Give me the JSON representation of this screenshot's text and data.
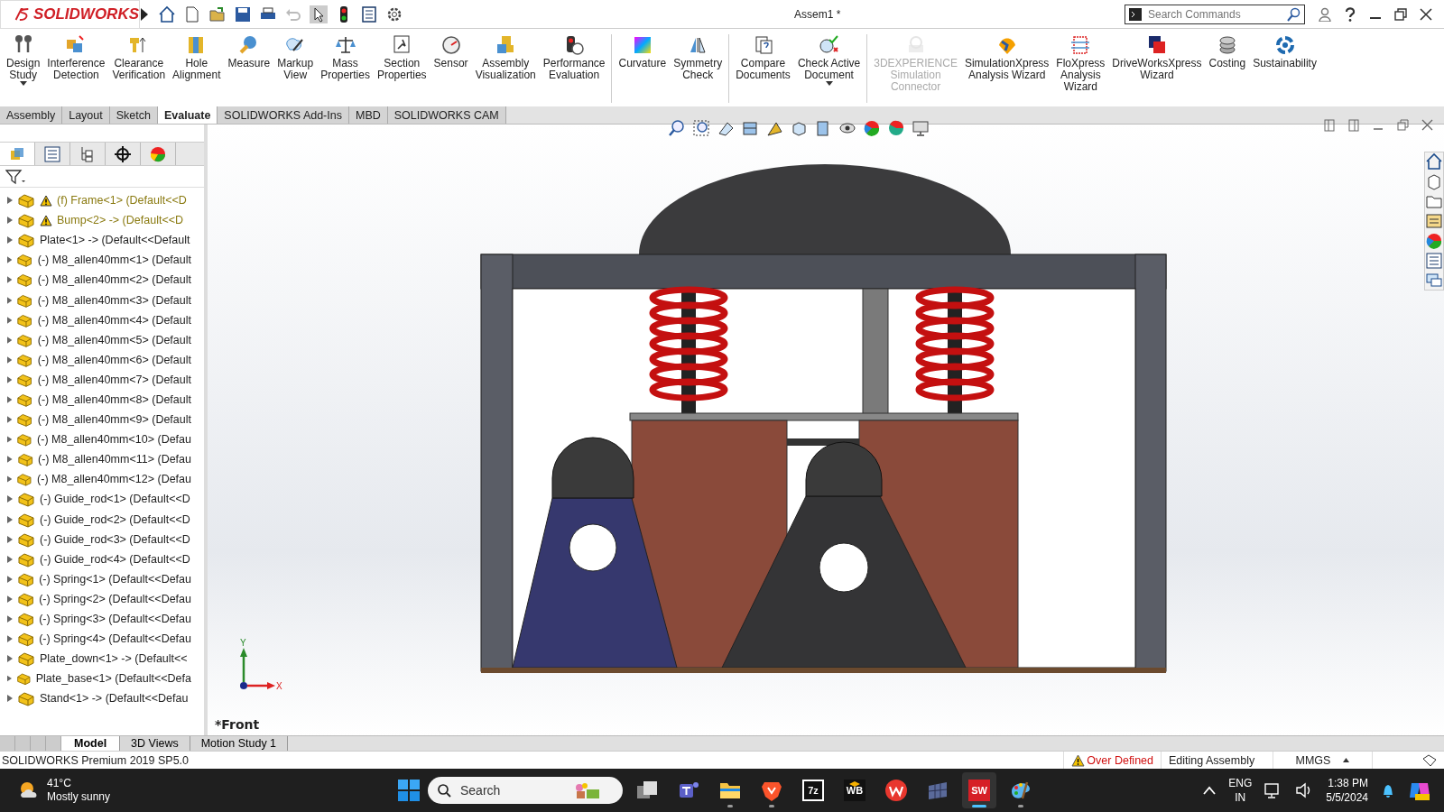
{
  "app": {
    "logo": "SOLIDWORKS",
    "title": "Assem1 *"
  },
  "search": {
    "placeholder": "Search Commands"
  },
  "ribbon": {
    "groups": [
      [
        {
          "label": "Design\nStudy",
          "dropdown": true,
          "disabled": false
        },
        {
          "label": "Interference\nDetection",
          "dropdown": false,
          "disabled": false
        },
        {
          "label": "Clearance\nVerification",
          "dropdown": false,
          "disabled": false
        },
        {
          "label": "Hole\nAlignment",
          "dropdown": false,
          "disabled": false
        },
        {
          "label": "Measure",
          "dropdown": false,
          "disabled": false
        },
        {
          "label": "Markup\nView",
          "dropdown": false,
          "disabled": false
        },
        {
          "label": "Mass\nProperties",
          "dropdown": false,
          "disabled": false
        },
        {
          "label": "Section\nProperties",
          "dropdown": false,
          "disabled": false
        },
        {
          "label": "Sensor",
          "dropdown": false,
          "disabled": false
        },
        {
          "label": "Assembly\nVisualization",
          "dropdown": false,
          "disabled": false
        },
        {
          "label": "Performance\nEvaluation",
          "dropdown": false,
          "disabled": false
        }
      ],
      [
        {
          "label": "Curvature",
          "dropdown": false,
          "disabled": false
        },
        {
          "label": "Symmetry\nCheck",
          "dropdown": false,
          "disabled": false
        }
      ],
      [
        {
          "label": "Compare\nDocuments",
          "dropdown": false,
          "disabled": false
        },
        {
          "label": "Check Active\nDocument",
          "dropdown": true,
          "disabled": false
        }
      ],
      [
        {
          "label": "3DEXPERIENCE\nSimulation\nConnector",
          "dropdown": false,
          "disabled": true
        },
        {
          "label": "SimulationXpress\nAnalysis Wizard",
          "dropdown": false,
          "disabled": false
        },
        {
          "label": "FloXpress\nAnalysis\nWizard",
          "dropdown": false,
          "disabled": false
        },
        {
          "label": "DriveWorksXpress\nWizard",
          "dropdown": false,
          "disabled": false
        },
        {
          "label": "Costing",
          "dropdown": false,
          "disabled": false
        },
        {
          "label": "Sustainability",
          "dropdown": false,
          "disabled": false
        }
      ]
    ]
  },
  "tabs": [
    {
      "label": "Assembly",
      "selected": false
    },
    {
      "label": "Layout",
      "selected": false
    },
    {
      "label": "Sketch",
      "selected": false
    },
    {
      "label": "Evaluate",
      "selected": true
    },
    {
      "label": "SOLIDWORKS Add-Ins",
      "selected": false
    },
    {
      "label": "MBD",
      "selected": false
    },
    {
      "label": "SOLIDWORKS CAM",
      "selected": false
    }
  ],
  "tree": {
    "items": [
      {
        "label": "(f) Frame<1> (Default<<D",
        "warning": true
      },
      {
        "label": "Bump<2> -> (Default<<D",
        "warning": true
      },
      {
        "label": "Plate<1> -> (Default<<Default",
        "warning": false
      },
      {
        "label": "(-) M8_allen40mm<1> (Default",
        "warning": false
      },
      {
        "label": "(-) M8_allen40mm<2> (Default",
        "warning": false
      },
      {
        "label": "(-) M8_allen40mm<3> (Default",
        "warning": false
      },
      {
        "label": "(-) M8_allen40mm<4> (Default",
        "warning": false
      },
      {
        "label": "(-) M8_allen40mm<5> (Default",
        "warning": false
      },
      {
        "label": "(-) M8_allen40mm<6> (Default",
        "warning": false
      },
      {
        "label": "(-) M8_allen40mm<7> (Default",
        "warning": false
      },
      {
        "label": "(-) M8_allen40mm<8> (Default",
        "warning": false
      },
      {
        "label": "(-) M8_allen40mm<9> (Default",
        "warning": false
      },
      {
        "label": "(-) M8_allen40mm<10> (Defau",
        "warning": false
      },
      {
        "label": "(-) M8_allen40mm<11> (Defau",
        "warning": false
      },
      {
        "label": "(-) M8_allen40mm<12> (Defau",
        "warning": false
      },
      {
        "label": "(-) Guide_rod<1> (Default<<D",
        "warning": false
      },
      {
        "label": "(-) Guide_rod<2> (Default<<D",
        "warning": false
      },
      {
        "label": "(-) Guide_rod<3> (Default<<D",
        "warning": false
      },
      {
        "label": "(-) Guide_rod<4> (Default<<D",
        "warning": false
      },
      {
        "label": "(-) Spring<1> (Default<<Defau",
        "warning": false
      },
      {
        "label": "(-) Spring<2> (Default<<Defau",
        "warning": false
      },
      {
        "label": "(-) Spring<3> (Default<<Defau",
        "warning": false
      },
      {
        "label": "(-) Spring<4> (Default<<Defau",
        "warning": false
      },
      {
        "label": "Plate_down<1> -> (Default<<",
        "warning": false
      },
      {
        "label": "Plate_base<1> (Default<<Defa",
        "warning": false
      },
      {
        "label": "Stand<1> -> (Default<<Defau",
        "warning": false
      }
    ]
  },
  "viewport": {
    "view_name": "*Front",
    "axis_x": "X",
    "axis_y": "Y"
  },
  "bottom_tabs": [
    {
      "label": "Model",
      "selected": true
    },
    {
      "label": "3D Views",
      "selected": false
    },
    {
      "label": "Motion Study 1",
      "selected": false
    }
  ],
  "status_bar": {
    "product": "SOLIDWORKS Premium 2019 SP5.0",
    "warning": "Over Defined",
    "mode": "Editing Assembly",
    "units": "MMGS"
  },
  "taskbar": {
    "temperature": "41°C",
    "weather": "Mostly sunny",
    "search_placeholder": "Search",
    "apps": [
      {
        "kind": "taskview",
        "running": false,
        "selected": false
      },
      {
        "kind": "teams",
        "running": false,
        "selected": false
      },
      {
        "kind": "explorer",
        "running": true,
        "selected": false
      },
      {
        "kind": "brave",
        "running": true,
        "selected": false
      },
      {
        "kind": "sevenzip",
        "text": "7z",
        "running": false,
        "selected": false
      },
      {
        "kind": "workbench",
        "text": "WB",
        "running": false,
        "selected": false
      },
      {
        "kind": "wps",
        "running": false,
        "selected": false
      },
      {
        "kind": "grid",
        "running": false,
        "selected": false
      },
      {
        "kind": "solidworks",
        "text": "SW",
        "running": true,
        "selected": true
      },
      {
        "kind": "paint",
        "running": true,
        "selected": false
      }
    ],
    "language": "ENG",
    "region": "IN",
    "time": "1:38 PM",
    "date": "5/5/2024"
  }
}
